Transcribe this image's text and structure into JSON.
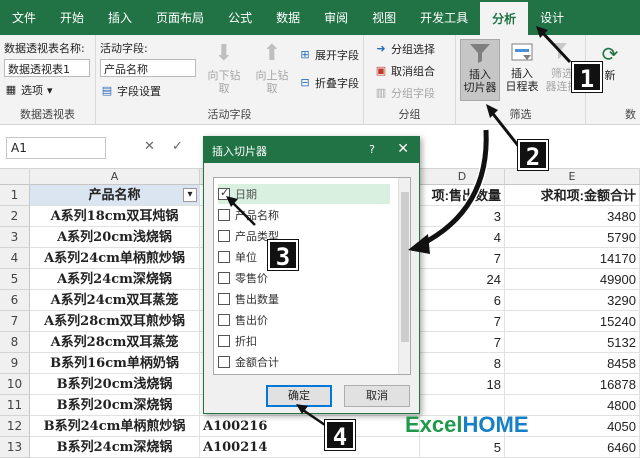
{
  "ribbon_tabs": [
    "文件",
    "开始",
    "插入",
    "页面布局",
    "公式",
    "数据",
    "审阅",
    "视图",
    "开发工具",
    "分析",
    "设计"
  ],
  "active_tab": "分析",
  "pivot_group": {
    "name_label": "数据透视表名称:",
    "name_value": "数据透视表1",
    "options_label": "选项",
    "title": "数据透视表"
  },
  "active_field_group": {
    "label": "活动字段:",
    "value": "产品名称",
    "field_settings": "字段设置",
    "drill_down": "向下钻取",
    "drill_up_1": "向上钻",
    "drill_up_2": "取",
    "expand": "展开字段",
    "collapse": "折叠字段",
    "title": "活动字段"
  },
  "group_group": {
    "group_selection": "分组选择",
    "ungroup": "取消组合",
    "group_field": "分组字段",
    "title": "分组"
  },
  "filter_group": {
    "insert_slicer_1": "插入",
    "insert_slicer_2": "切片器",
    "insert_timeline_1": "插入",
    "insert_timeline_2": "日程表",
    "filter_conn_1": "筛选",
    "filter_conn_2": "器连接",
    "title": "筛选"
  },
  "extra_group": {
    "refresh": "新",
    "data": "数"
  },
  "formula_bar": {
    "cell_ref": "A1",
    "cancel": "✕",
    "confirm": "✓"
  },
  "columns": [
    "A",
    "D",
    "E"
  ],
  "rows": [
    {
      "n": "1",
      "a": "产品名称",
      "d": "项:售出数量",
      "e": "求和项:金额合计"
    },
    {
      "n": "2",
      "a": "A系列18cm双耳炖锅",
      "d": "3",
      "e": "3480"
    },
    {
      "n": "3",
      "a": "A系列20cm浅烧锅",
      "d": "4",
      "e": "5790"
    },
    {
      "n": "4",
      "a": "A系列24cm单柄煎炒锅",
      "d": "7",
      "e": "14170"
    },
    {
      "n": "5",
      "a": "A系列24cm深烧锅",
      "d": "24",
      "e": "49900"
    },
    {
      "n": "6",
      "a": "A系列24cm双耳蒸笼",
      "d": "6",
      "e": "3290"
    },
    {
      "n": "7",
      "a": "A系列28cm双耳煎炒锅",
      "d": "7",
      "e": "15240"
    },
    {
      "n": "8",
      "a": "A系列28cm双耳蒸笼",
      "d": "7",
      "e": "5132"
    },
    {
      "n": "9",
      "a": "B系列16cm单柄奶锅",
      "d": "8",
      "e": "8458"
    },
    {
      "n": "10",
      "a": "B系列20cm浅烧锅",
      "d": "18",
      "e": "16878"
    },
    {
      "n": "11",
      "a": "B系列20cm深烧锅",
      "d": "",
      "e": "4800"
    },
    {
      "n": "12",
      "a": "B系列24cm单柄煎炒锅",
      "b": "A100216",
      "d": "",
      "e": "4050"
    },
    {
      "n": "13",
      "a": "B系列24cm深烧锅",
      "b": "A100214",
      "d": "5",
      "e": "6460"
    }
  ],
  "dialog": {
    "title": "插入切片器",
    "help": "?",
    "close": "✕",
    "items": [
      "日期",
      "产品名称",
      "产品类型",
      "单位",
      "零售价",
      "售出数量",
      "售出价",
      "折扣",
      "金额合计"
    ],
    "checked_index": 0,
    "ok": "确定",
    "cancel": "取消"
  },
  "markers": [
    "1",
    "2",
    "3",
    "4"
  ],
  "logo": {
    "excel": "Excel",
    "home": "HOME"
  },
  "colors": {
    "accent": "#217346",
    "header_fill": "#dbe5f1"
  }
}
